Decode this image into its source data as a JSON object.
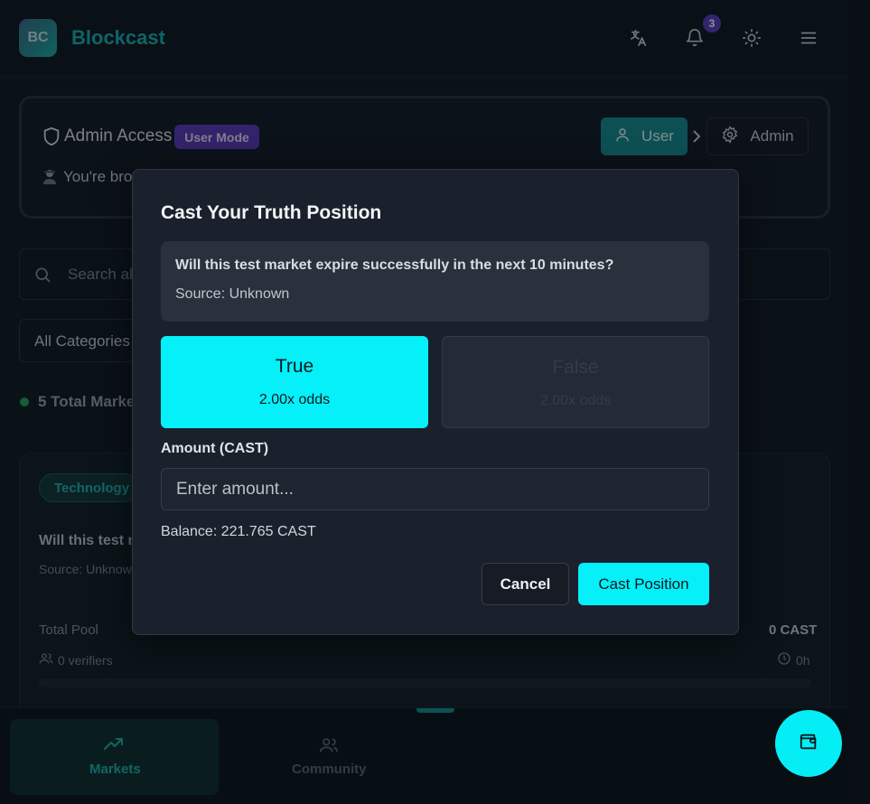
{
  "header": {
    "logo_text": "BC",
    "brand": "Blockcast",
    "notification_count": "3",
    "icons": [
      "translate-icon",
      "bell-icon",
      "sun-icon",
      "menu-icon"
    ]
  },
  "admin_panel": {
    "title": "Admin Access",
    "mode_badge": "User Mode",
    "description": "You're bro",
    "user_button": "User",
    "admin_button": "Admin"
  },
  "filters": {
    "search_placeholder": "Search al",
    "category": "All Categories",
    "total_markets": "5 Total Marke"
  },
  "market_card": {
    "tag": "Technology",
    "question": "Will this test m",
    "source": "Source: Unknow",
    "pool_label": "Total Pool",
    "pool_value": "0 CAST",
    "verifiers": "0 verifiers",
    "time_left": "0h",
    "progress": 0
  },
  "bottom_nav": {
    "markets": "Markets",
    "community": "Community"
  },
  "modal": {
    "title": "Cast Your Truth Position",
    "question": "Will this test market expire successfully in the next 10 minutes?",
    "source": "Source: Unknown",
    "option_true": {
      "label": "True",
      "odds": "2.00x odds",
      "selected": true
    },
    "option_false": {
      "label": "False",
      "odds": "2.00x odds",
      "selected": false
    },
    "amount_label": "Amount (CAST)",
    "amount_placeholder": "Enter amount...",
    "balance": "Balance: 221.765 CAST",
    "cancel": "Cancel",
    "submit": "Cast Position"
  },
  "colors": {
    "accent": "#05f0f8",
    "brand": "#17b3b5",
    "badge": "#5c3bb8"
  }
}
